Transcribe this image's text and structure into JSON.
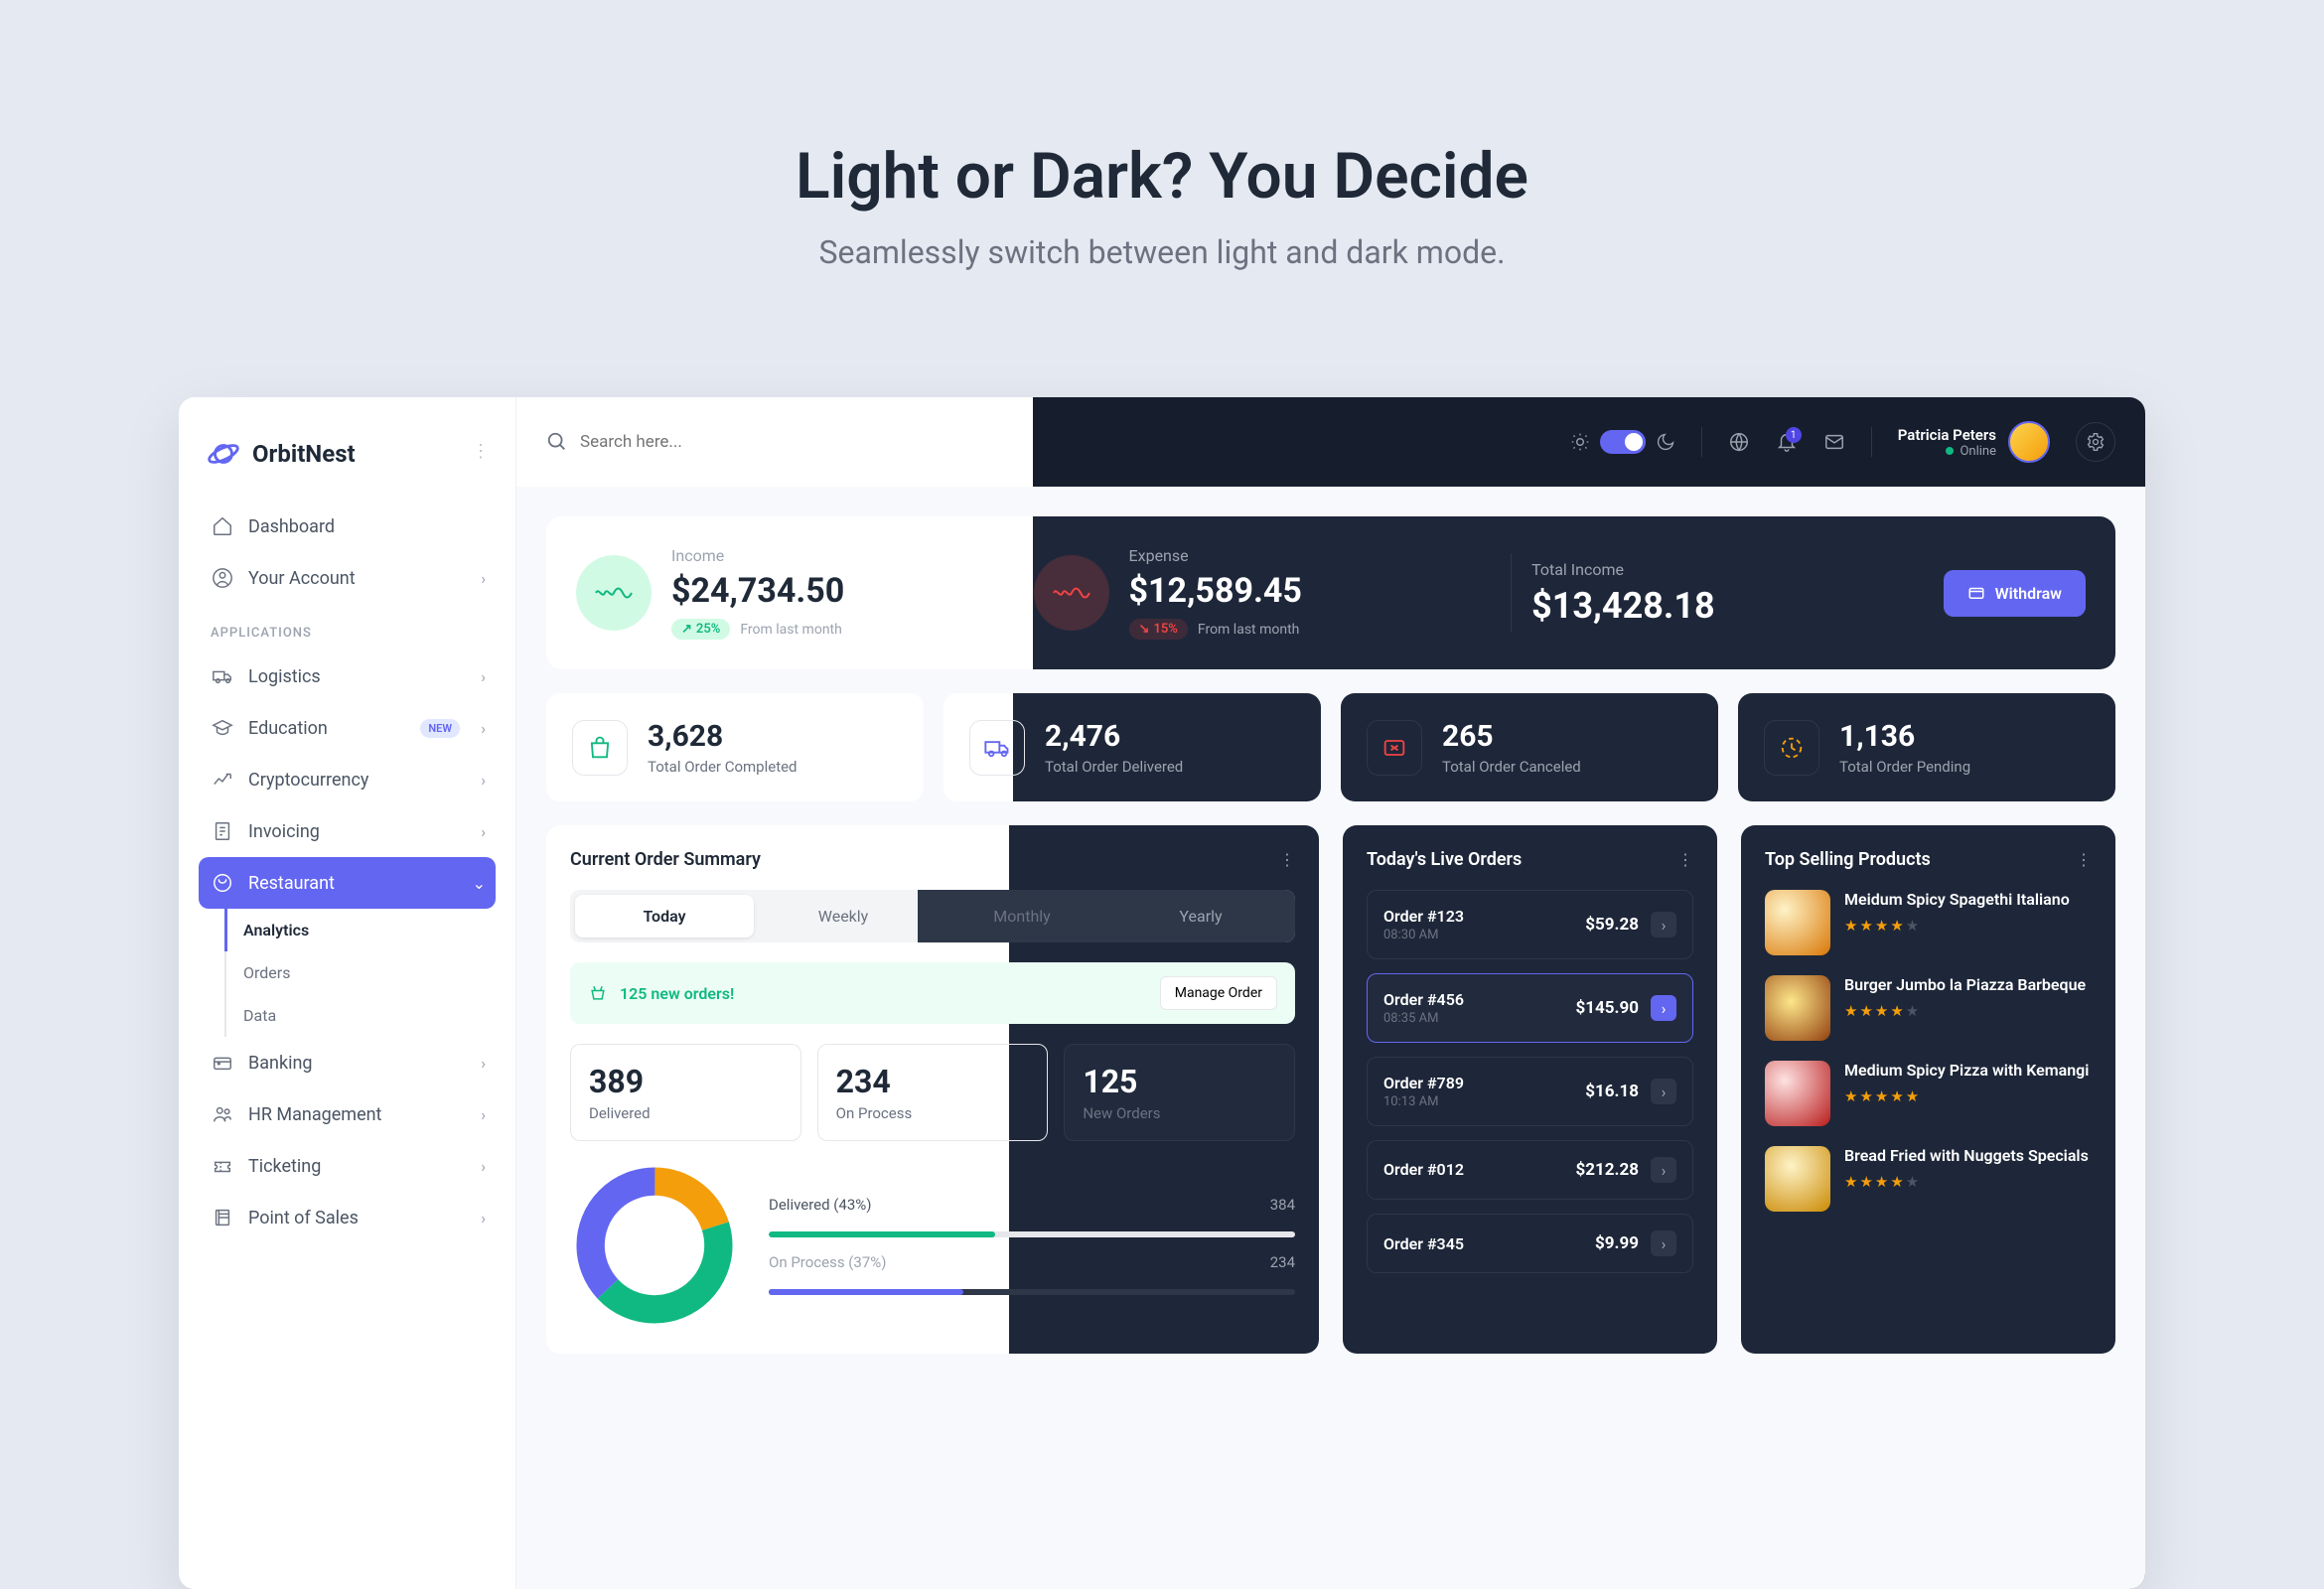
{
  "hero": {
    "title": "Light or Dark? You Decide",
    "subtitle": "Seamlessly switch between light and dark mode."
  },
  "brand": "OrbitNest",
  "search": {
    "placeholder": "Search here..."
  },
  "user": {
    "name": "Patricia Peters",
    "status": "Online",
    "notif_count": "1"
  },
  "nav": {
    "dashboard": "Dashboard",
    "account": "Your Account",
    "applications_header": "APPLICATIONS",
    "logistics": "Logistics",
    "education": "Education",
    "education_badge": "NEW",
    "crypto": "Cryptocurrency",
    "invoicing": "Invoicing",
    "restaurant": "Restaurant",
    "sub": {
      "analytics": "Analytics",
      "orders": "Orders",
      "data": "Data"
    },
    "banking": "Banking",
    "hr": "HR Management",
    "ticketing": "Ticketing",
    "pos": "Point of Sales"
  },
  "kpi": {
    "income": {
      "label": "Income",
      "value": "$24,734.50",
      "delta": "25%",
      "meta": "From last month"
    },
    "expense": {
      "label": "Expense",
      "value": "$12,589.45",
      "delta": "15%",
      "meta": "From last month"
    },
    "total": {
      "label": "Total Income",
      "value": "$13,428.18"
    },
    "withdraw": "Withdraw"
  },
  "stats": [
    {
      "value": "3,628",
      "label": "Total Order Completed"
    },
    {
      "value": "2,476",
      "label": "Total Order Delivered"
    },
    {
      "value": "265",
      "label": "Total Order Canceled"
    },
    {
      "value": "1,136",
      "label": "Total Order Pending"
    }
  ],
  "summary": {
    "title": "Current Order Summary",
    "tabs": [
      "Today",
      "Weekly",
      "Monthly",
      "Yearly"
    ],
    "alert_text": "125 new orders!",
    "manage_btn": "Manage Order",
    "mini": [
      {
        "value": "389",
        "label": "Delivered"
      },
      {
        "value": "234",
        "label": "On Process"
      },
      {
        "value": "125",
        "label": "New Orders"
      }
    ],
    "legend": [
      {
        "label": "Delivered (43%)",
        "count": "384",
        "pct": 43,
        "color": "#10B981"
      },
      {
        "label": "On Process (37%)",
        "count": "234",
        "pct": 37,
        "color": "#6366F1"
      }
    ]
  },
  "live_orders": {
    "title": "Today's Live Orders",
    "items": [
      {
        "id": "Order #123",
        "time": "08:30 AM",
        "price": "$59.28"
      },
      {
        "id": "Order #456",
        "time": "08:35 AM",
        "price": "$145.90"
      },
      {
        "id": "Order #789",
        "time": "10:13 AM",
        "price": "$16.18"
      },
      {
        "id": "Order #012",
        "time": "",
        "price": "$212.28"
      },
      {
        "id": "Order #345",
        "time": "",
        "price": "$9.99"
      }
    ]
  },
  "top_products": {
    "title": "Top Selling Products",
    "items": [
      {
        "name": "Meidum Spicy Spagethi Italiano",
        "rating": 4
      },
      {
        "name": "Burger Jumbo la Piazza Barbeque",
        "rating": 4
      },
      {
        "name": "Medium Spicy Pizza with Kemangi",
        "rating": 5
      },
      {
        "name": "Bread Fried with Nuggets Specials",
        "rating": 4
      }
    ]
  },
  "chart_data": {
    "type": "pie",
    "title": "Current Order Summary",
    "series": [
      {
        "name": "Delivered",
        "value": 43,
        "color": "#10B981"
      },
      {
        "name": "On Process",
        "value": 37,
        "color": "#6366F1"
      },
      {
        "name": "New Orders",
        "value": 20,
        "color": "#F59E0B"
      }
    ],
    "counts": {
      "Delivered": 384,
      "On Process": 234
    }
  }
}
